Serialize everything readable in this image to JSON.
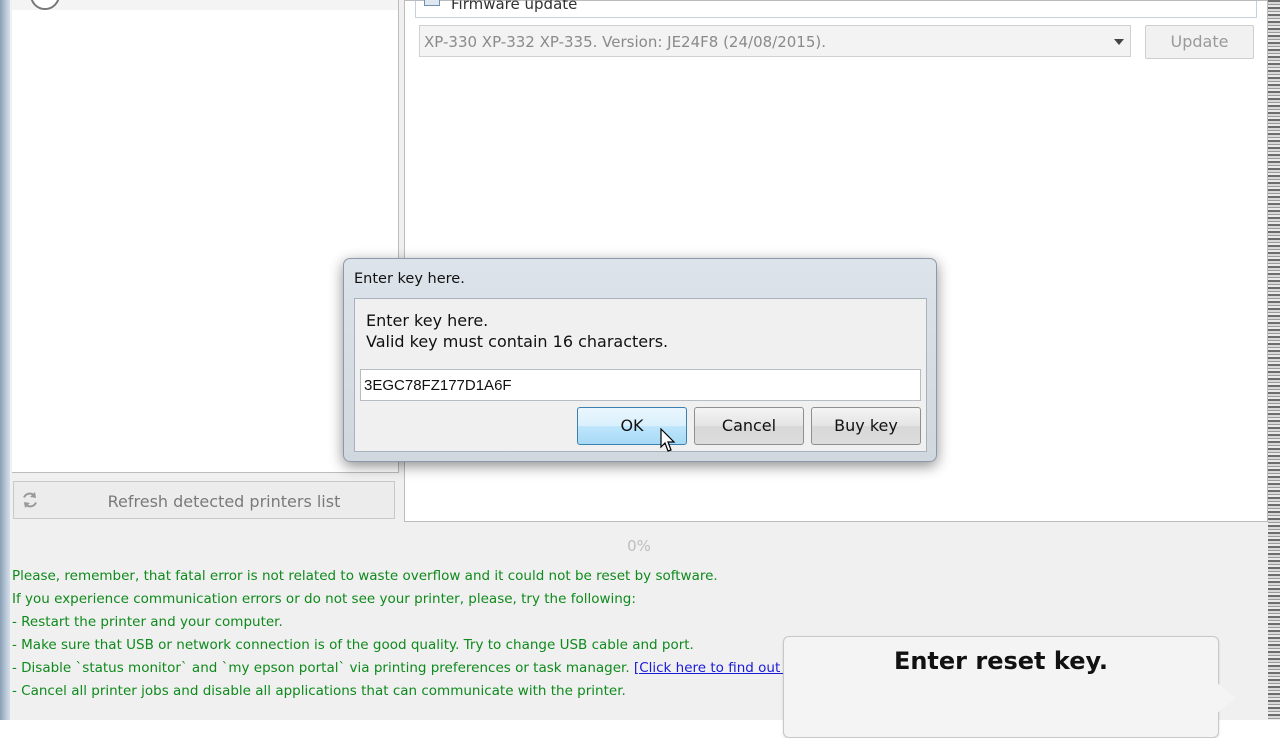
{
  "left_panel": {
    "refresh_label": "Refresh detected printers list"
  },
  "firmware": {
    "section_label": "Firmware update",
    "selected_version": "XP-330 XP-332 XP-335. Version: JE24F8 (24/08/2015).",
    "update_label": "Update"
  },
  "progress": {
    "text": "0%",
    "value": 0
  },
  "log": {
    "lines": [
      "Please, remember, that fatal error is not related to waste overflow and it could not be reset by software.",
      "If you experience communication errors or do not see your printer, please, try the following:",
      "- Restart the printer and your computer.",
      "- Make sure that USB or network connection is of the good quality. Try to change USB cable and port.",
      "- Disable `status monitor` and `my epson portal` via printing preferences or task manager. ",
      "- Cancel all printer jobs  and disable all applications that can communicate with the printer."
    ],
    "link_text": "[Click here to find out how]"
  },
  "callout": {
    "text": "Enter reset key."
  },
  "dialog": {
    "title": "Enter key here.",
    "message_line1": "Enter key here.",
    "message_line2": "Valid key must contain 16 characters.",
    "key_value": "3EGC78FZ177D1A6F",
    "ok_label": "OK",
    "cancel_label": "Cancel",
    "buy_label": "Buy key"
  },
  "colors": {
    "log_text": "#0f8a1c",
    "link": "#1a1ad8",
    "ok_button": "#bee6fd"
  }
}
